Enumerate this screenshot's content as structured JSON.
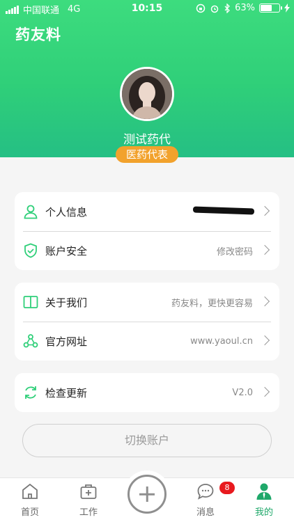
{
  "status_bar": {
    "carrier": "中国联通",
    "network": "4G",
    "time": "10:15",
    "battery_text": "63%",
    "battery_level": 0.63
  },
  "brand": {
    "title": "药友料"
  },
  "profile": {
    "name": "测试药代",
    "role": "医药代表"
  },
  "menu": {
    "personal_info": {
      "label": "个人信息",
      "icon": "person-icon"
    },
    "account_security": {
      "label": "账户安全",
      "value": "修改密码",
      "icon": "shield-check-icon"
    },
    "about_us": {
      "label": "关于我们",
      "value": "药友料，更快更容易",
      "icon": "book-icon"
    },
    "website": {
      "label": "官方网址",
      "value": "www.yaoul.cn",
      "icon": "share-nodes-icon"
    },
    "check_update": {
      "label": "检查更新",
      "value": "V2.0",
      "icon": "refresh-icon"
    }
  },
  "switch_account": {
    "label": "切换账户"
  },
  "tabbar": {
    "home": {
      "label": "首页",
      "icon": "home-icon"
    },
    "work": {
      "label": "工作",
      "icon": "briefcase-plus-icon"
    },
    "add": {
      "icon": "plus-icon"
    },
    "messages": {
      "label": "消息",
      "icon": "chat-bubble-icon",
      "badge": "8"
    },
    "mine": {
      "label": "我的",
      "icon": "user-icon"
    }
  },
  "colors": {
    "accent": "#2fcf79",
    "badge": "#f2a22c",
    "notification": "#e8191e"
  }
}
